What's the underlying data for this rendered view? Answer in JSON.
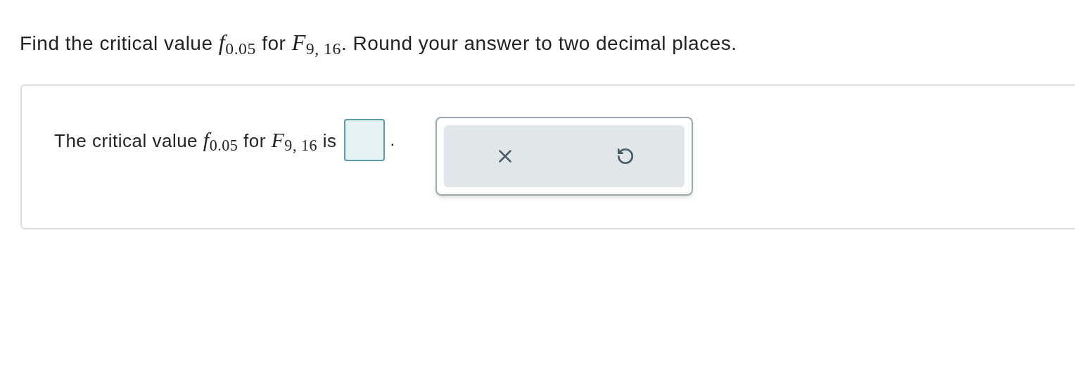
{
  "question": "Find the critical value *f*$_{0.05}$ for *F*$_{9, 16}$. Round your answer to two decimal places.",
  "answer": {
    "prefix": "The critical value *f*$_{0.05}$ for *F*$_{9, 16}$ is",
    "suffix": "."
  }
}
